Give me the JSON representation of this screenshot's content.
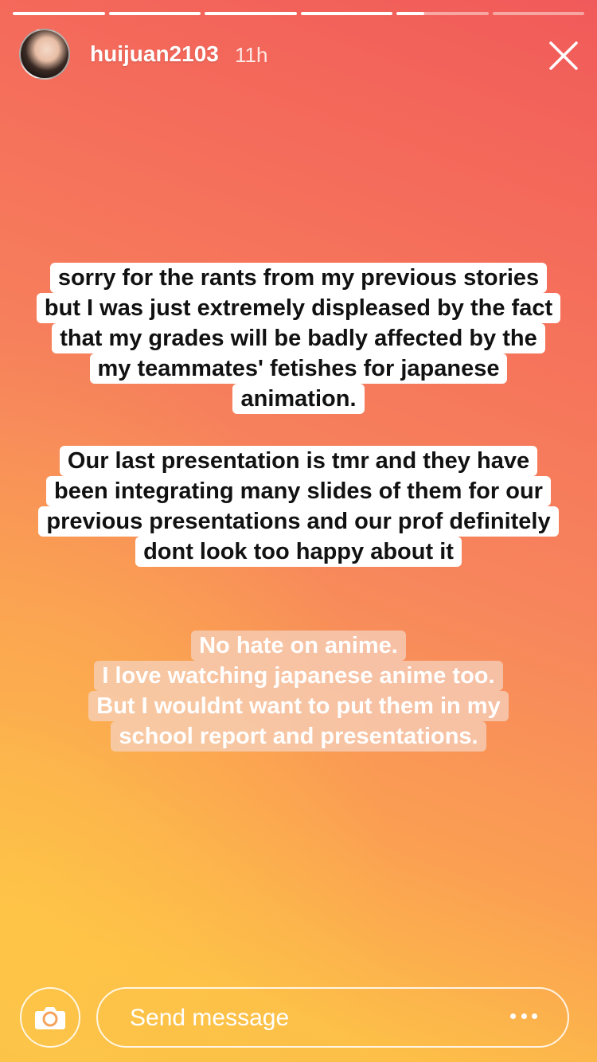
{
  "story": {
    "progress": [
      1,
      1,
      1,
      1,
      0.3,
      0
    ],
    "user": {
      "username": "huijuan2103",
      "time": "11h"
    },
    "text_blocks": [
      {
        "style": "solid",
        "lines": [
          "sorry for the rants from my previous stories",
          "but I was just extremely displeased by the fact",
          "that my grades will be badly affected by the",
          "my teammates' fetishes for japanese",
          "animation."
        ]
      },
      {
        "style": "solid",
        "lines": [
          "Our last presentation is tmr and they have",
          "been integrating many slides of them for our",
          "previous presentations and our prof definitely",
          "dont look too happy about it"
        ]
      },
      {
        "style": "faded",
        "lines": [
          "No hate on anime.",
          "I love watching japanese anime too.",
          "But I wouldnt want to put them in my",
          "school report and presentations."
        ]
      }
    ]
  },
  "footer": {
    "message_placeholder": "Send message",
    "camera_icon": "camera-icon",
    "more_icon": "more-options-icon"
  },
  "icons": {
    "close": "close-icon"
  }
}
